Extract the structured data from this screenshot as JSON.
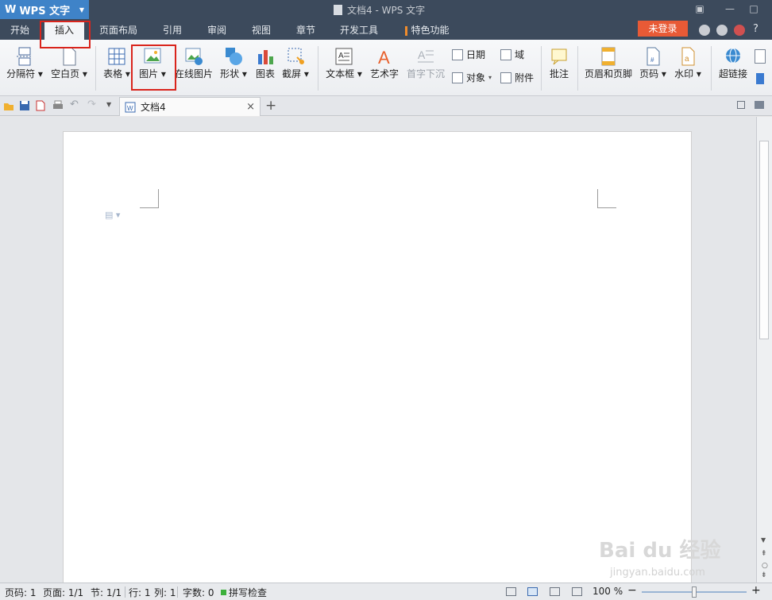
{
  "app": {
    "name": "WPS 文字",
    "doc_title": "文档4 - WPS 文字"
  },
  "menu": {
    "tabs": [
      "开始",
      "插入",
      "页面布局",
      "引用",
      "审阅",
      "视图",
      "章节",
      "开发工具",
      "特色功能"
    ],
    "active_tab": "插入",
    "login_label": "未登录",
    "help_label": "?"
  },
  "ribbon": {
    "page_break": "分隔符",
    "blank_page": "空白页",
    "table": "表格",
    "picture": "图片",
    "online_picture": "在线图片",
    "shapes": "形状",
    "chart": "图表",
    "screenshot": "截屏",
    "textbox": "文本框",
    "wordart": "艺术字",
    "dropcap": "首字下沉",
    "date": "日期",
    "field": "域",
    "object": "对象",
    "attachment": "附件",
    "comment": "批注",
    "header_footer": "页眉和页脚",
    "page_number": "页码",
    "watermark": "水印",
    "hyperlink": "超链接"
  },
  "tabs": {
    "doc_name": "文档4",
    "close": "×",
    "new": "+"
  },
  "status": {
    "page": "页码: 1",
    "pages": "页面: 1/1",
    "section": "节: 1/1",
    "row": "行: 1",
    "col": "列: 1",
    "words": "字数: 0",
    "spell": "拼写检查",
    "zoom": "100 %",
    "zoom_out": "−",
    "zoom_in": "+"
  },
  "watermark": {
    "brand": "Bai du 经验",
    "url": "jingyan.baidu.com"
  },
  "colors": {
    "accent": "#3f83c8",
    "titlebar": "#3c4a5c",
    "login": "#e85a36",
    "highlight": "#d9241c"
  }
}
